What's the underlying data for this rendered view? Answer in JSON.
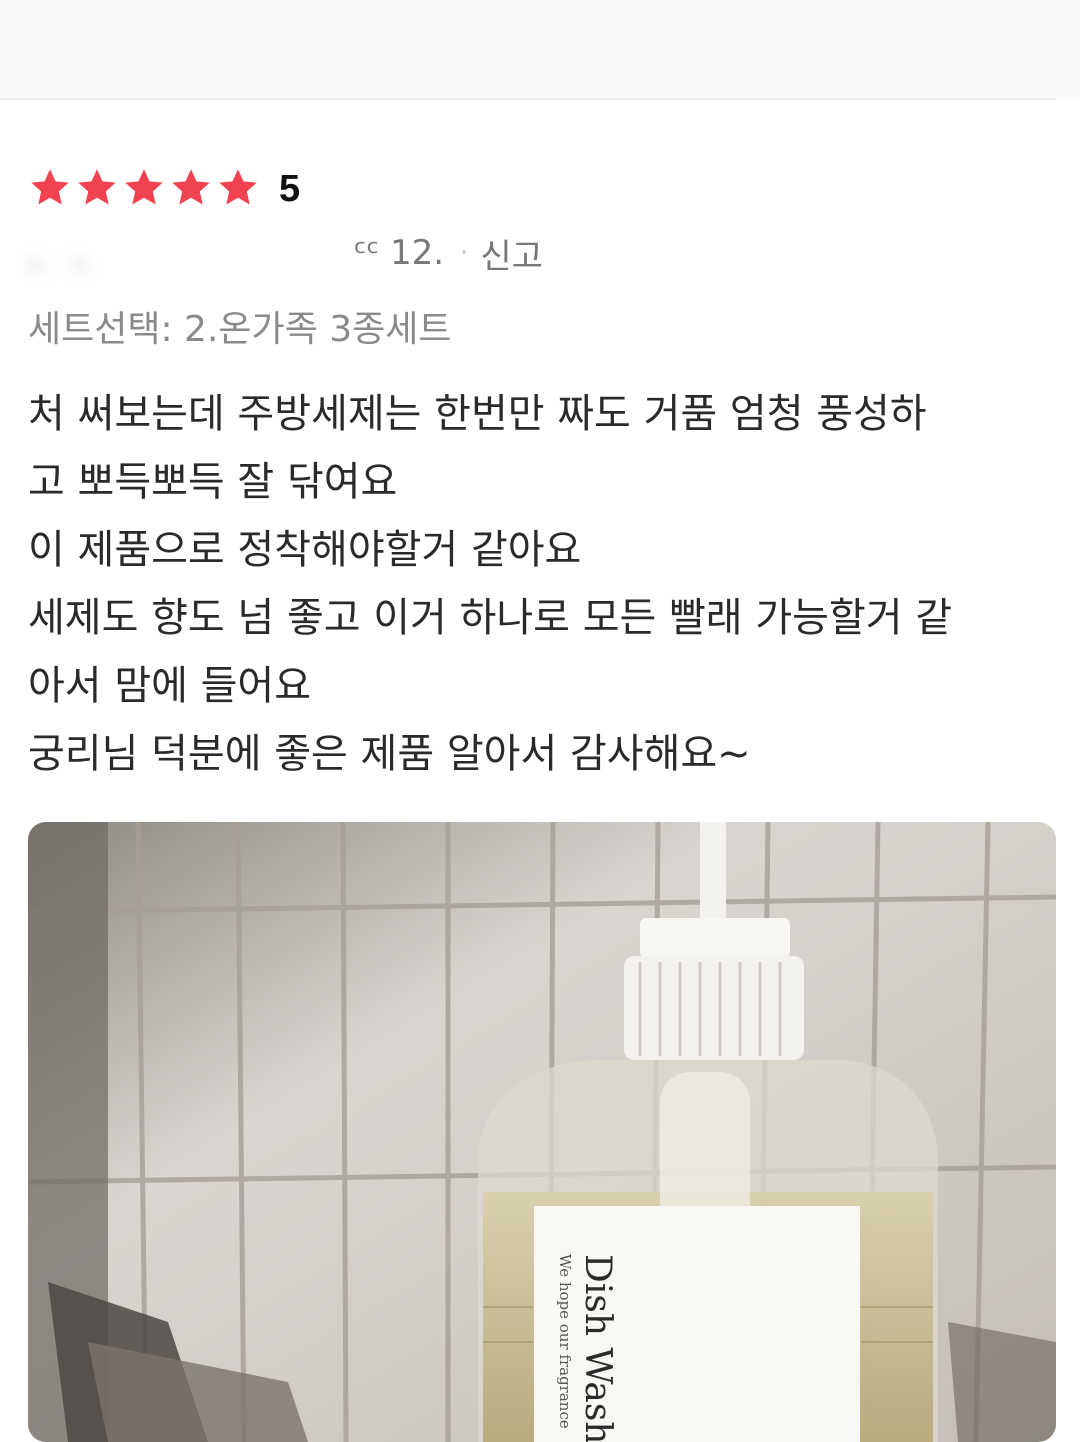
{
  "review": {
    "rating": 5,
    "rating_text": "5",
    "reviewer": "、 、",
    "date": "ᶜᶜ 12.",
    "separator": "·",
    "report_label": "신고",
    "option": "세트선택: 2.온가족 3종세트",
    "body_lines": [
      "처 써보는데 주방세제는 한번만 짜도 거품 엄청 풍성하",
      "고 뽀득뽀득 잘 닦여요",
      "이 제품으로 정착해야할거 같아요",
      "세제도 향도 넘 좋고 이거 하나로 모든 빨래 가능할거 같",
      "아서 맘에 들어요",
      "궁리님 덕분에 좋은 제품 알아서 감사해요~"
    ],
    "photo": {
      "label_title": "Dish Washi",
      "label_subtitle": "We hope our fragrance"
    }
  },
  "colors": {
    "star": "#f0434f",
    "text": "#2a2a2a",
    "muted": "#8a8a8a"
  }
}
